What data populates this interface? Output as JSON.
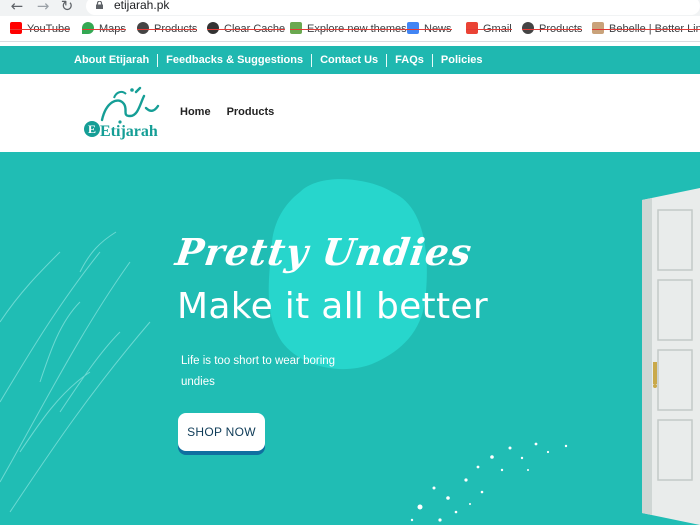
{
  "browser": {
    "url": "etijarah.pk",
    "bookmarks": [
      {
        "label": "YouTube",
        "color": "#ff0000"
      },
      {
        "label": "Maps",
        "color": "#34a853"
      },
      {
        "label": "Products",
        "color": "#444444"
      },
      {
        "label": "Clear Cache",
        "color": "#444444"
      },
      {
        "label": "Explore new themes",
        "color": "#6aa84f"
      },
      {
        "label": "News",
        "color": "#4285f4"
      },
      {
        "label": "Gmail",
        "color": "#ea4335"
      },
      {
        "label": "Products",
        "color": "#444444"
      },
      {
        "label": "Bebelle | Better Lin...",
        "color": "#c9a27a"
      }
    ]
  },
  "topbar": {
    "links": [
      "About Etijarah",
      "Feedbacks & Suggestions",
      "Contact Us",
      "FAQs",
      "Policies"
    ],
    "color": "#1fb8b0"
  },
  "header": {
    "logo_text": "Etijarah",
    "logo_initial": "E",
    "nav": [
      "Home",
      "Products"
    ]
  },
  "hero": {
    "script_title": "Pretty Undies",
    "headline": "Make it all better",
    "tagline": "Life is too short to wear boring undies",
    "button": "SHOP NOW",
    "bg_color": "#20bdb4",
    "accent_color": "#27d6cc"
  }
}
